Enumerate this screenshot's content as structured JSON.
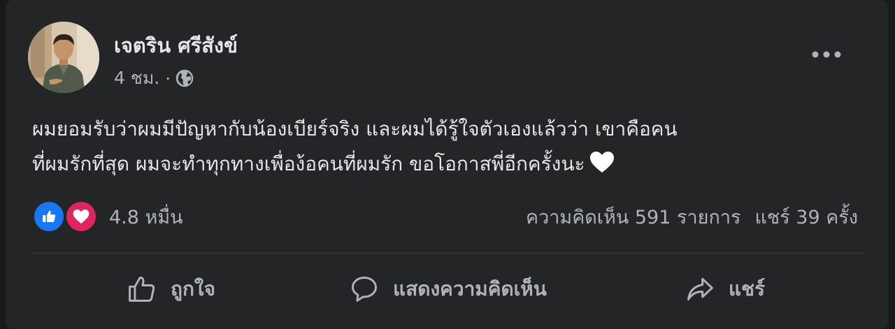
{
  "post": {
    "author_name": "เจตริน ศรีสังข์",
    "timestamp": "4 ชม.",
    "separator": "·",
    "audience_icon": "globe-icon",
    "more_icon": "more-options-icon",
    "text_line1": "ผมยอมรับว่าผมมีปัญหากับน้องเบียร์จริง และผมได้รู้ใจตัวเองแล้วว่า เขาคือคน",
    "text_line2": "ที่ผมรักที่สุด ผมจะทำทุกทางเพื่อง้อคนที่ผมรัก ขอโอกาสพี่อีกครั้งนะ",
    "emoji_icon": "white-heart-icon"
  },
  "reactions": {
    "icons": [
      "like-reaction-icon",
      "love-reaction-icon"
    ],
    "count": "4.8 หมื่น"
  },
  "stats": {
    "comments": "ความคิดเห็น 591 รายการ",
    "shares": "แชร์ 39 ครั้ง"
  },
  "actions": {
    "like_label": "ถูกใจ",
    "comment_label": "แสดงความคิดเห็น",
    "share_label": "แชร์"
  },
  "colors": {
    "page_background": "#18191a",
    "card_background": "#242526",
    "primary_text": "#e4e6eb",
    "secondary_text": "#b0b3b8",
    "divider": "#3e4042",
    "like_blue": "#1877f2",
    "love_red": "#e0245e"
  }
}
